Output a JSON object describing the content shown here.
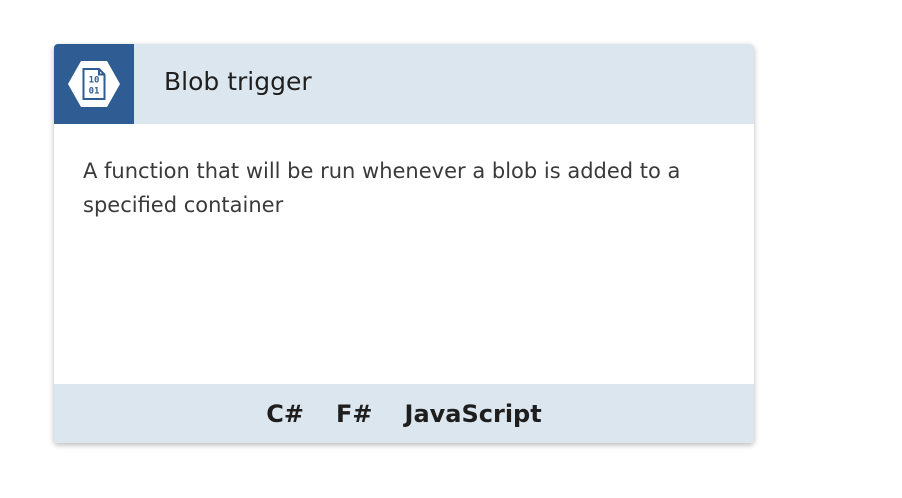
{
  "card": {
    "title": "Blob trigger",
    "description": "A function that will be run whenever a blob is added to a specified container",
    "icon": {
      "name": "blob-binary-icon",
      "line1": "10",
      "line2": "01"
    },
    "languages": [
      "C#",
      "F#",
      "JavaScript"
    ]
  },
  "colors": {
    "icon_background": "#2f5d93",
    "header_background": "#dce6ef",
    "footer_background": "#dce6ef"
  }
}
